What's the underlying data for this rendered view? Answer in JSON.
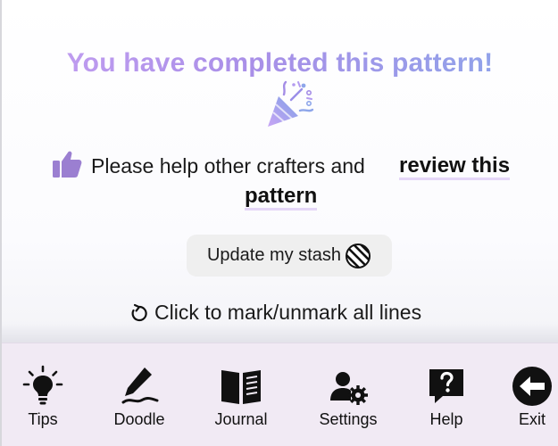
{
  "completion": {
    "title": "You have completed this pattern!"
  },
  "review": {
    "text": "Please help other crafters and",
    "link_line1": "review this",
    "link_line2": "pattern"
  },
  "stash_button": {
    "label": "Update my stash"
  },
  "mark_lines": {
    "label": "Click to mark/unmark all lines"
  },
  "toolbar": {
    "items": [
      {
        "label": "Tips",
        "icon": "lightbulb-icon"
      },
      {
        "label": "Doodle",
        "icon": "pen-icon"
      },
      {
        "label": "Journal",
        "icon": "book-icon"
      },
      {
        "label": "Settings",
        "icon": "user-gear-icon"
      },
      {
        "label": "Help",
        "icon": "question-icon"
      },
      {
        "label": "Exit",
        "icon": "exit-arrow-icon"
      }
    ]
  },
  "colors": {
    "title_gradient_start": "#c6a0f2",
    "title_gradient_end": "#8ba7ea",
    "accent_purple": "#9b7fd1",
    "toolbar_bg": "#f1eaf4",
    "button_bg": "#efefef"
  }
}
